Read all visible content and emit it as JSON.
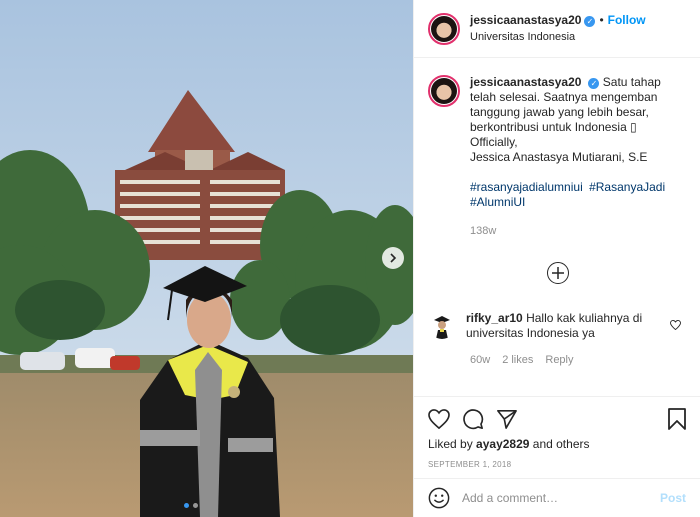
{
  "post": {
    "username": "jessicaanastasya20",
    "verified": true,
    "follow_label": "Follow",
    "location": "Universitas Indonesia",
    "bullet": "•"
  },
  "caption": {
    "username": "jessicaanastasya20",
    "line1": "Satu tahap telah selesai. Saatnya mengemban tanggung jawab yang lebih besar, berkontribusi untuk Indonesia ",
    "emoji": "▯",
    "line2": "Officially,",
    "line3": "Jessica Anastasya Mutiarani, S.E",
    "hashtags": [
      "#rasanyajadialumniui",
      "#RasanyaJadi",
      "#AlumniUI"
    ],
    "time": "138w"
  },
  "comments": [
    {
      "username": "rifky_ar10",
      "text": "Hallo kak kuliahnya di universitas Indonesia ya",
      "time": "60w",
      "likes": "2 likes",
      "reply_label": "Reply"
    }
  ],
  "actions": {
    "liked_by_prefix": "Liked by",
    "liked_by_user": "ayay2829",
    "liked_by_suffix": "and others",
    "date": "SEPTEMBER 1, 2018"
  },
  "composer": {
    "placeholder": "Add a comment…",
    "post_label": "Post"
  },
  "carousel": {
    "slides": 2,
    "active_index": 0
  },
  "colors": {
    "accent": "#0095f6",
    "link": "#00376b",
    "muted": "#8e8e8e",
    "post_disabled": "#b2dffc"
  }
}
